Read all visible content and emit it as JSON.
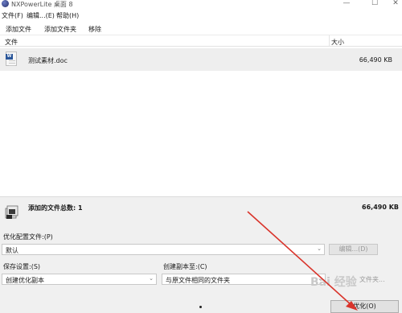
{
  "window": {
    "title": "NXPowerLite 桌面 8",
    "controls": [
      "—",
      "☐",
      "✕"
    ]
  },
  "menu": {
    "items": [
      "文件(F)",
      "编辑...(E)",
      "帮助(H)"
    ]
  },
  "toolbar": {
    "add_file": "添加文件",
    "add_folder": "添加文件夹",
    "remove": "移除"
  },
  "file_list": {
    "columns": {
      "file": "文件",
      "size": "大小"
    },
    "rows": [
      {
        "name": "测试素材.doc",
        "size": "66,490 KB",
        "icon": "word-doc-icon"
      }
    ]
  },
  "summary": {
    "label": "添加的文件总数: 1",
    "size": "66,490 KB"
  },
  "optimize_profile": {
    "label": "优化配置文件:(P)",
    "value": "默认",
    "edit_button": "编辑...(D)"
  },
  "save_settings": {
    "label": "保存设置:(S)",
    "value": "创建优化副本"
  },
  "copy_to": {
    "label": "创建副本至:(C)",
    "value": "与原文件相同的文件夹",
    "browse_partial": "文件夹..."
  },
  "optimize_button": "优化(O)",
  "watermark": "Bai 经验",
  "colors": {
    "arrow": "#d9342b",
    "panel": "#f0f0f0",
    "selected_row": "#eeeeee"
  }
}
